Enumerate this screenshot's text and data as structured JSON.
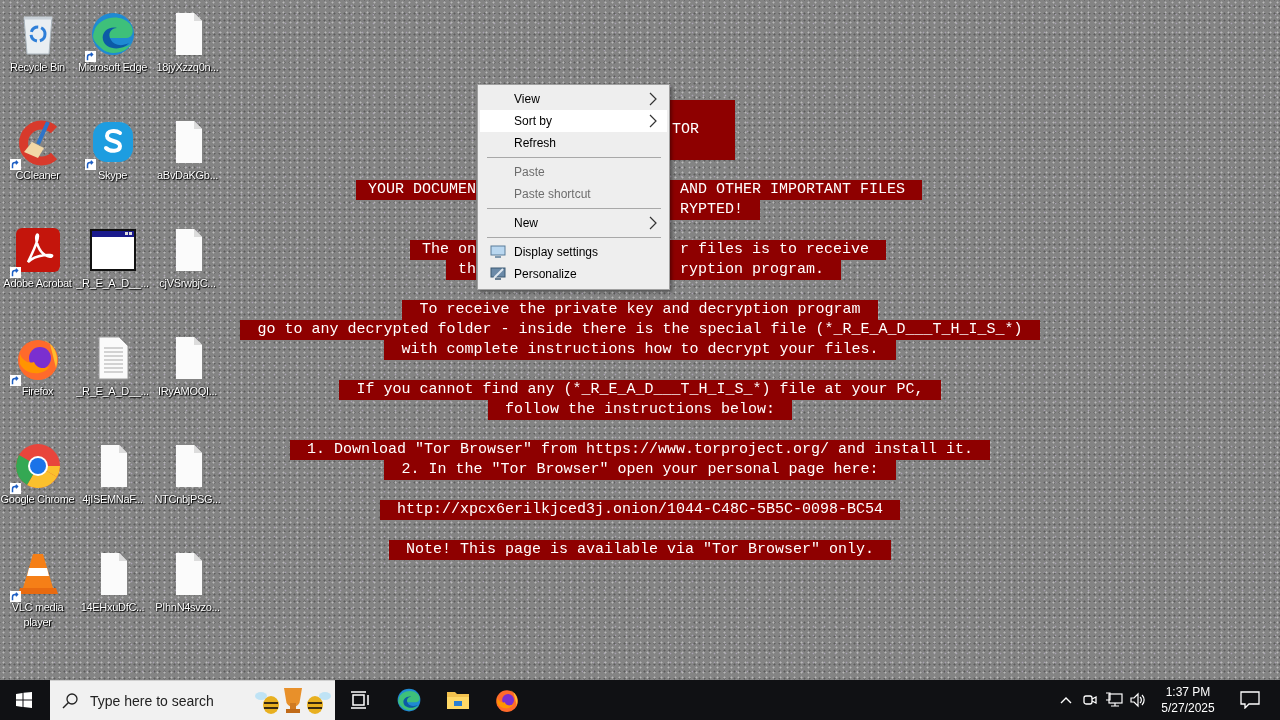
{
  "desktop_icons": [
    {
      "label": "Recycle Bin",
      "kind": "recycle-bin",
      "shortcut": false
    },
    {
      "label": "CCleaner",
      "kind": "ccleaner",
      "shortcut": true
    },
    {
      "label": "Adobe Acrobat",
      "kind": "acrobat",
      "shortcut": true
    },
    {
      "label": "Firefox",
      "kind": "firefox",
      "shortcut": true
    },
    {
      "label": "Google Chrome",
      "kind": "chrome",
      "shortcut": true
    },
    {
      "label": "VLC media player",
      "kind": "vlc",
      "shortcut": true
    },
    {
      "label": "Microsoft Edge",
      "kind": "edge",
      "shortcut": true
    },
    {
      "label": "Skype",
      "kind": "skype",
      "shortcut": true
    },
    {
      "label": "_R_E_A_D__...",
      "kind": "app-window",
      "shortcut": false
    },
    {
      "label": "_R_E_A_D__...",
      "kind": "text-file",
      "shortcut": false
    },
    {
      "label": "4jISEMNaF...",
      "kind": "file",
      "shortcut": false
    },
    {
      "label": "14EHxuDfC...",
      "kind": "file",
      "shortcut": false
    },
    {
      "label": "18jyXzzq0n...",
      "kind": "file",
      "shortcut": false
    },
    {
      "label": "aBvDaKGb...",
      "kind": "file",
      "shortcut": false
    },
    {
      "label": "cjVSrwbjC...",
      "kind": "file",
      "shortcut": false
    },
    {
      "label": "IRyAMOQI...",
      "kind": "file",
      "shortcut": false
    },
    {
      "label": "NTCnbjPSG...",
      "kind": "file",
      "shortcut": false
    },
    {
      "label": "PIhnN4svzo...",
      "kind": "file",
      "shortcut": false
    }
  ],
  "wallpaper_note": [
    [
      {
        "kind": "heading",
        "right": "TOR"
      }
    ],
    [
      {
        "kind": "split",
        "left": "YOUR DOCUMEN",
        "right": "AND OTHER IMPORTANT FILES"
      },
      {
        "kind": "split",
        "right": "RYPTED!"
      }
    ],
    [
      {
        "kind": "split",
        "left": "The on",
        "right": "r files is to receive"
      },
      {
        "kind": "split",
        "left": "th",
        "right": "ryption program."
      }
    ],
    [
      {
        "kind": "line",
        "text": "To receive the private key and decryption program"
      },
      {
        "kind": "line",
        "text": "go to any decrypted folder - inside there is the special file (*_R_E_A_D___T_H_I_S_*)"
      },
      {
        "kind": "line",
        "text": "with complete instructions how to decrypt your files."
      }
    ],
    [
      {
        "kind": "line",
        "text": "If you cannot find any (*_R_E_A_D___T_H_I_S_*) file at your PC,"
      },
      {
        "kind": "line",
        "text": "follow the instructions below:"
      }
    ],
    [
      {
        "kind": "line",
        "text": "1. Download \"Tor Browser\" from https://www.torproject.org/ and install it."
      },
      {
        "kind": "line",
        "text": "2. In the \"Tor Browser\" open your personal page here:"
      }
    ],
    [
      {
        "kind": "line",
        "text": "http://xpcx6erilkjced3j.onion/1044-C48C-5B5C-0098-BC54"
      }
    ],
    [
      {
        "kind": "line",
        "text": "Note! This page is available via \"Tor Browser\" only."
      }
    ]
  ],
  "context_menu": [
    {
      "kind": "item",
      "label": "View",
      "submenu": true,
      "disabled": false,
      "selected": false,
      "has_icon": false
    },
    {
      "kind": "item",
      "label": "Sort by",
      "submenu": true,
      "disabled": false,
      "selected": true,
      "has_icon": false
    },
    {
      "kind": "item",
      "label": "Refresh",
      "submenu": false,
      "disabled": false,
      "selected": false,
      "has_icon": false
    },
    {
      "kind": "separator"
    },
    {
      "kind": "item",
      "label": "Paste",
      "submenu": false,
      "disabled": true,
      "selected": false,
      "has_icon": false
    },
    {
      "kind": "item",
      "label": "Paste shortcut",
      "submenu": false,
      "disabled": true,
      "selected": false,
      "has_icon": false
    },
    {
      "kind": "separator"
    },
    {
      "kind": "item",
      "label": "New",
      "submenu": true,
      "disabled": false,
      "selected": false,
      "has_icon": false
    },
    {
      "kind": "separator"
    },
    {
      "kind": "item",
      "label": "Display settings",
      "submenu": false,
      "disabled": false,
      "selected": false,
      "has_icon": true
    },
    {
      "kind": "item",
      "label": "Personalize",
      "submenu": false,
      "disabled": false,
      "selected": false,
      "has_icon": true
    }
  ],
  "taskbar": {
    "search": {
      "placeholder": "Type here to search"
    },
    "clock": {
      "time": "1:37 PM",
      "date": "5/27/2025"
    }
  }
}
